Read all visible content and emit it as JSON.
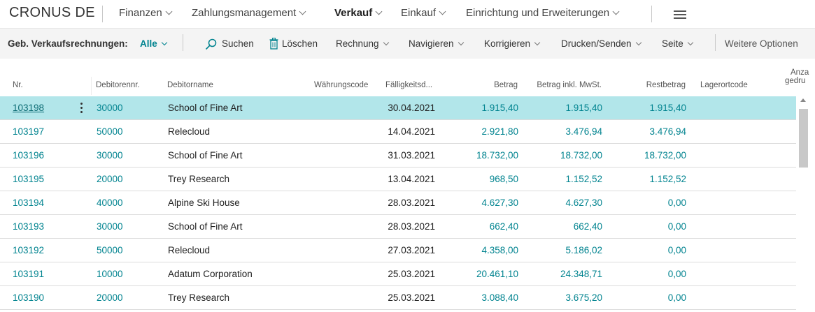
{
  "app": {
    "company": "CRONUS DE"
  },
  "nav": {
    "items": [
      {
        "label": "Finanzen",
        "active": false
      },
      {
        "label": "Zahlungsmanagement",
        "active": false
      },
      {
        "label": "Verkauf",
        "active": true
      },
      {
        "label": "Einkauf",
        "active": false
      },
      {
        "label": "Einrichtung und Erweiterungen",
        "active": false
      }
    ],
    "menu_icon": "hamburger-menu-icon"
  },
  "actionbar": {
    "page_label": "Geb. Verkaufsrechnungen:",
    "filter_value": "Alle",
    "actions": {
      "search": "Suchen",
      "delete": "Löschen",
      "invoice": "Rechnung",
      "navigate": "Navigieren",
      "correct": "Korrigieren",
      "print_send": "Drucken/Senden",
      "page": "Seite",
      "more": "Weitere Optionen"
    }
  },
  "table": {
    "columns": {
      "nr": "Nr.",
      "customer_no": "Debitorennr.",
      "customer_name": "Debitorname",
      "currency": "Währungscode",
      "due_date": "Fälligkeitsd...",
      "amount": "Betrag",
      "amount_vat": "Betrag inkl. MwSt.",
      "remaining": "Restbetrag",
      "location": "Lagerortcode",
      "printed_line1": "Anza",
      "printed_line2": "gedru"
    },
    "rows": [
      {
        "nr": "103198",
        "customer_no": "30000",
        "customer_name": "School of Fine Art",
        "due_date": "30.04.2021",
        "amount": "1.915,40",
        "amount_vat": "1.915,40",
        "remaining": "1.915,40"
      },
      {
        "nr": "103197",
        "customer_no": "50000",
        "customer_name": "Relecloud",
        "due_date": "14.04.2021",
        "amount": "2.921,80",
        "amount_vat": "3.476,94",
        "remaining": "3.476,94"
      },
      {
        "nr": "103196",
        "customer_no": "30000",
        "customer_name": "School of Fine Art",
        "due_date": "31.03.2021",
        "amount": "18.732,00",
        "amount_vat": "18.732,00",
        "remaining": "18.732,00"
      },
      {
        "nr": "103195",
        "customer_no": "20000",
        "customer_name": "Trey Research",
        "due_date": "13.04.2021",
        "amount": "968,50",
        "amount_vat": "1.152,52",
        "remaining": "1.152,52"
      },
      {
        "nr": "103194",
        "customer_no": "40000",
        "customer_name": "Alpine Ski House",
        "due_date": "28.03.2021",
        "amount": "4.627,30",
        "amount_vat": "4.627,30",
        "remaining": "0,00"
      },
      {
        "nr": "103193",
        "customer_no": "30000",
        "customer_name": "School of Fine Art",
        "due_date": "28.03.2021",
        "amount": "662,40",
        "amount_vat": "662,40",
        "remaining": "0,00"
      },
      {
        "nr": "103192",
        "customer_no": "50000",
        "customer_name": "Relecloud",
        "due_date": "27.03.2021",
        "amount": "4.358,00",
        "amount_vat": "5.186,02",
        "remaining": "0,00"
      },
      {
        "nr": "103191",
        "customer_no": "10000",
        "customer_name": "Adatum Corporation",
        "due_date": "25.03.2021",
        "amount": "20.461,10",
        "amount_vat": "24.348,71",
        "remaining": "0,00"
      },
      {
        "nr": "103190",
        "customer_no": "20000",
        "customer_name": "Trey Research",
        "due_date": "25.03.2021",
        "amount": "3.088,40",
        "amount_vat": "3.675,20",
        "remaining": "0,00"
      }
    ]
  },
  "colors": {
    "accent": "#00838f",
    "selected_row": "#b2e6ea"
  }
}
